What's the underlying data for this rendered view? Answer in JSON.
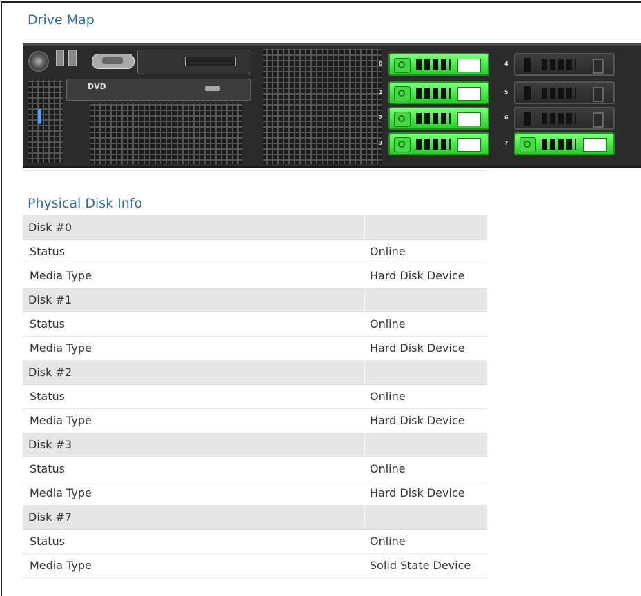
{
  "drive_map": {
    "title": "Drive Map",
    "dvd_label": "DVD",
    "bays": [
      {
        "number": "0",
        "state": "active"
      },
      {
        "number": "1",
        "state": "active"
      },
      {
        "number": "2",
        "state": "active"
      },
      {
        "number": "3",
        "state": "active"
      },
      {
        "number": "4",
        "state": "empty"
      },
      {
        "number": "5",
        "state": "empty"
      },
      {
        "number": "6",
        "state": "empty"
      },
      {
        "number": "7",
        "state": "active"
      }
    ],
    "colors": {
      "active_drive": "#3fe83f",
      "empty_drive": "#2a2a2a",
      "chassis": "#2b2b2b"
    }
  },
  "disk_info": {
    "title": "Physical Disk Info",
    "disks": [
      {
        "name": "Disk #0",
        "status_label": "Status",
        "status": "Online",
        "media_label": "Media Type",
        "media": "Hard Disk Device"
      },
      {
        "name": "Disk #1",
        "status_label": "Status",
        "status": "Online",
        "media_label": "Media Type",
        "media": "Hard Disk Device"
      },
      {
        "name": "Disk #2",
        "status_label": "Status",
        "status": "Online",
        "media_label": "Media Type",
        "media": "Hard Disk Device"
      },
      {
        "name": "Disk #3",
        "status_label": "Status",
        "status": "Online",
        "media_label": "Media Type",
        "media": "Hard Disk Device"
      },
      {
        "name": "Disk #7",
        "status_label": "Status",
        "status": "Online",
        "media_label": "Media Type",
        "media": "Solid State Device"
      }
    ]
  },
  "colors": {
    "section_title": "#2e6da4",
    "header_row": "#e6e6e6"
  }
}
